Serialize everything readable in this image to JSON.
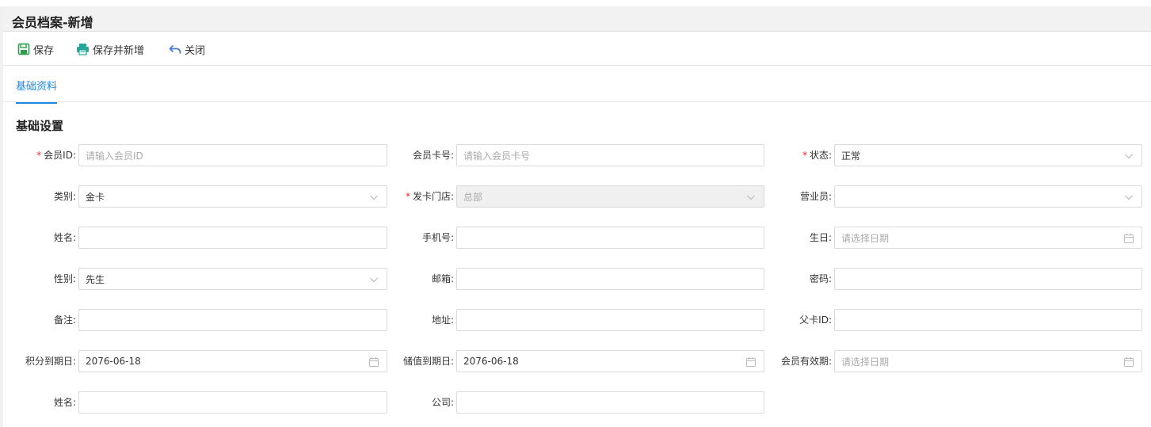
{
  "window": {
    "title": "会员档案-新增"
  },
  "toolbar": {
    "save": "保存",
    "save_new": "保存并新增",
    "close": "关闭"
  },
  "tabs": [
    {
      "label": "基础资料"
    }
  ],
  "section": {
    "title": "基础设置"
  },
  "fields": {
    "member_id": {
      "label": "会员ID:",
      "required": "*",
      "placeholder": "请输入会员ID"
    },
    "card_no": {
      "label": "会员卡号:",
      "placeholder": "请输入会员卡号"
    },
    "status": {
      "label": "状态:",
      "required": "*",
      "value": "正常"
    },
    "category": {
      "label": "类别:",
      "value": "金卡"
    },
    "issue_store": {
      "label": "发卡门店:",
      "required": "*",
      "value": "总部"
    },
    "salesperson": {
      "label": "营业员:",
      "value": ""
    },
    "name": {
      "label": "姓名:",
      "value": ""
    },
    "mobile": {
      "label": "手机号:",
      "value": ""
    },
    "birthday": {
      "label": "生日:",
      "placeholder": "请选择日期"
    },
    "gender": {
      "label": "性别:",
      "value": "先生"
    },
    "email": {
      "label": "邮箱:",
      "value": ""
    },
    "password": {
      "label": "密码:",
      "value": ""
    },
    "remark": {
      "label": "备注:",
      "value": ""
    },
    "address": {
      "label": "地址:",
      "value": ""
    },
    "parent_card": {
      "label": "父卡ID:",
      "value": ""
    },
    "points_expiry": {
      "label": "积分到期日:",
      "value": "2076-06-18"
    },
    "stored_expiry": {
      "label": "储值到期日:",
      "value": "2076-06-18"
    },
    "member_validity": {
      "label": "会员有效期:",
      "placeholder": "请选择日期"
    },
    "name2": {
      "label": "姓名:",
      "value": ""
    },
    "company": {
      "label": "公司:",
      "value": ""
    }
  },
  "colors": {
    "accent": "#1e88e5",
    "required": "#f5222d",
    "save_icon": "#2e9e4f",
    "print_icon": "#26a69a",
    "close_icon": "#4a7fc1"
  }
}
